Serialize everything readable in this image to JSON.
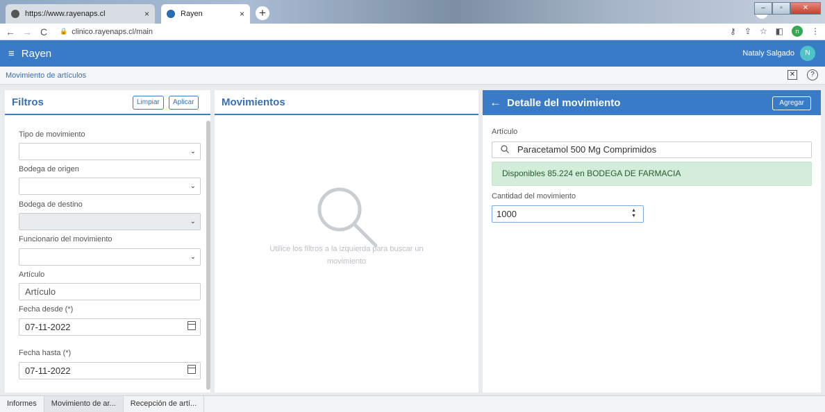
{
  "browser": {
    "tabs": [
      {
        "title": "https://www.rayenaps.cl",
        "close": "×"
      },
      {
        "title": "Rayen",
        "close": "×"
      }
    ],
    "new_tab": "+",
    "url": "clinico.rayenaps.cl/main",
    "profile_initial": "n",
    "win_minimize": "–",
    "win_maximize": "▫",
    "win_close": "✕",
    "tab_dropdown": "⌄"
  },
  "app": {
    "brand": "Rayen",
    "menu_icon": "≡",
    "user_name": "Nataly Salgado",
    "user_initial": "N",
    "accent_color": "#3a7bc8"
  },
  "breadcrumb": "Movimiento de artículos",
  "filters": {
    "title": "Filtros",
    "clear_label": "Limpiar",
    "apply_label": "Aplicar",
    "tipo_label": "Tipo de movimiento",
    "origen_label": "Bodega de origen",
    "destino_label": "Bodega de destino",
    "funcionario_label": "Funcionario del movimiento",
    "articulo_label": "Artículo",
    "articulo_placeholder": "Artículo",
    "desde_label": "Fecha desde (*)",
    "desde_value": "07-11-2022",
    "hasta_label": "Fecha hasta (*)",
    "hasta_value": "07-11-2022"
  },
  "movimientos": {
    "title": "Movimientos",
    "empty_text": "Utilice los filtros a la izquierda para buscar un movimiento"
  },
  "detalle": {
    "title": "Detalle del movimiento",
    "back_icon": "←",
    "add_label": "Agregar",
    "articulo_label": "Artículo",
    "articulo_value": "Paracetamol 500 Mg Comprimidos",
    "disponibles_text": "Disponibles 85.224 en BODEGA DE FARMACIA",
    "cantidad_label": "Cantidad del movimiento",
    "cantidad_value": "1000"
  },
  "bottom_tabs": [
    "Informes",
    "Movimiento de ar...",
    "Recepción de artí..."
  ]
}
